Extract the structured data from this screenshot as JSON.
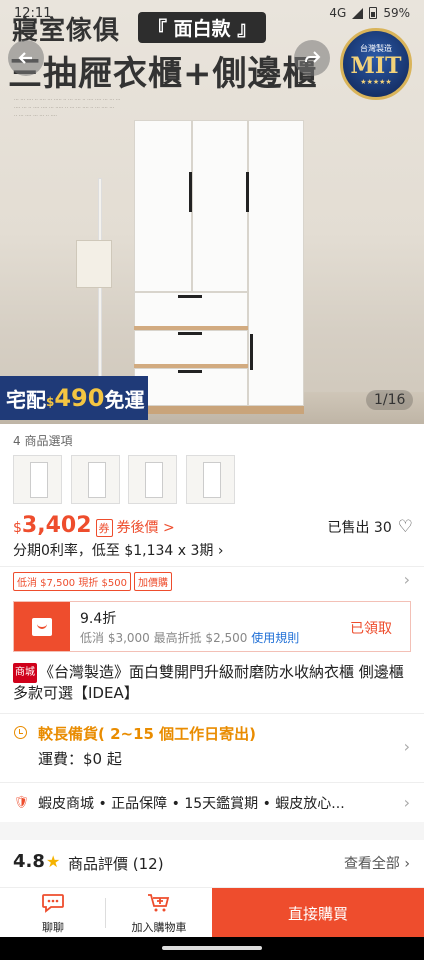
{
  "status_bar": {
    "time": "12:11",
    "network": "4G",
    "battery": "59%"
  },
  "hero": {
    "ad_line1": "寢室傢俱",
    "ad_badge": "『 面白款 』",
    "ad_line2": "三抽屜衣櫃+側邊櫃",
    "mit_top": "台灣製造",
    "mit_main": "MIT",
    "promo_a": "宅配",
    "promo_currency": "$",
    "promo_amount": "490",
    "promo_b": "免運",
    "page_indicator": "1/16"
  },
  "options": {
    "label": "4 商品選項",
    "count": 4
  },
  "price": {
    "currency": "$",
    "amount": "3,402",
    "coupon_icon": "券",
    "after_coupon": "券後價 >",
    "sold": "已售出 30",
    "installment": "分期0利率，低至 $1,134 x 3期 ›"
  },
  "tags": [
    "低消 $7,500 現折 $500",
    "加價購"
  ],
  "voucher": {
    "title": "9.4折",
    "subtitle": "低消 $3,000 最高折抵 $2,500",
    "rules": "使用規則",
    "status": "已領取"
  },
  "product": {
    "mall_badge": "商城",
    "title": "《台灣製造》面白雙開門升級耐磨防水收納衣櫃 側邊櫃 多款可選【IDEA】"
  },
  "shipping": {
    "line1": "較長備貨( 2~15 個工作日寄出)",
    "line2": "運費：$0 起"
  },
  "guarantee": {
    "text": "蝦皮商城 • 正品保障 • 15天鑑賞期 • 蝦皮放心..."
  },
  "rating": {
    "score": "4.8",
    "label": "商品評價 (12)",
    "view_all": "查看全部 ›"
  },
  "bottom_bar": {
    "chat_label": "聊聊",
    "cart_label": "加入購物車",
    "buy_label": "直接購買"
  },
  "colors": {
    "accent": "#ee4d2d",
    "promo_blue": "#1f3a78",
    "shipping_orange": "#e98c00"
  }
}
